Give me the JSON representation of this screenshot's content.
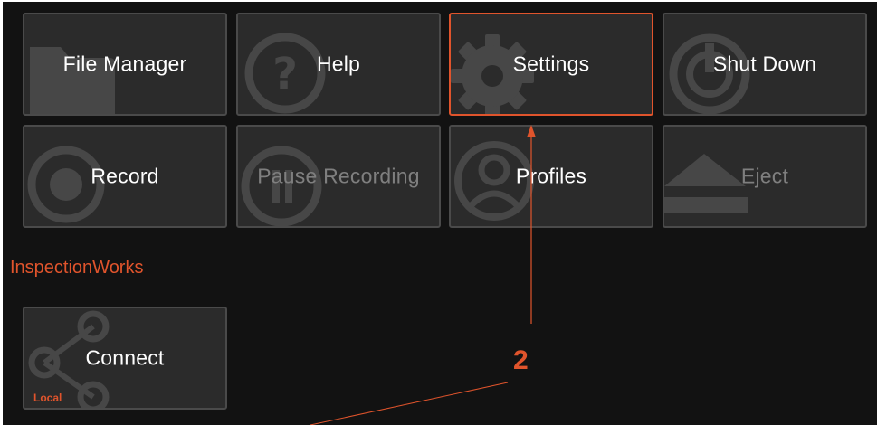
{
  "menu": {
    "tiles": [
      {
        "label": "File Manager",
        "icon": "folder-icon",
        "enabled": true,
        "selected": false
      },
      {
        "label": "Help",
        "icon": "question-icon",
        "enabled": true,
        "selected": false
      },
      {
        "label": "Settings",
        "icon": "gear-icon",
        "enabled": true,
        "selected": true
      },
      {
        "label": "Shut Down",
        "icon": "power-icon",
        "enabled": true,
        "selected": false
      },
      {
        "label": "Record",
        "icon": "record-icon",
        "enabled": true,
        "selected": false
      },
      {
        "label": "Pause Recording",
        "icon": "pause-icon",
        "enabled": false,
        "selected": false
      },
      {
        "label": "Profiles",
        "icon": "user-profile-icon",
        "enabled": true,
        "selected": false
      },
      {
        "label": "Eject",
        "icon": "eject-icon",
        "enabled": false,
        "selected": false
      }
    ]
  },
  "inspectionworks": {
    "section_title": "InspectionWorks",
    "connect": {
      "label": "Connect",
      "badge": "Local",
      "icon": "share-icon"
    }
  },
  "annotation": {
    "number": "2",
    "color": "#e0542c"
  },
  "colors": {
    "accent": "#e0542c",
    "tile_bg": "#2b2b2b",
    "tile_border": "#4a4a4a",
    "screen_bg": "#121212",
    "icon_ghost": "#474747"
  }
}
